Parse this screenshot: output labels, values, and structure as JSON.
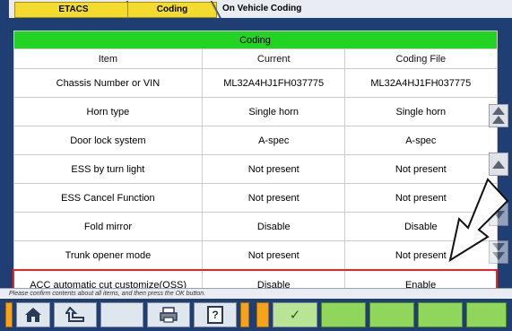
{
  "tabs": {
    "etacs": "ETACS",
    "coding": "Coding",
    "current": "On Vehicle Coding"
  },
  "table": {
    "title": "Coding",
    "headers": [
      "Item",
      "Current",
      "Coding File"
    ],
    "rows": [
      {
        "item": "Chassis Number or VIN",
        "current": "ML32A4HJ1FH037775",
        "file": "ML32A4HJ1FH037775"
      },
      {
        "item": "Horn type",
        "current": "Single horn",
        "file": "Single horn"
      },
      {
        "item": "Door lock system",
        "current": "A-spec",
        "file": "A-spec"
      },
      {
        "item": "ESS by turn light",
        "current": "Not present",
        "file": "Not present"
      },
      {
        "item": "ESS Cancel Function",
        "current": "Not present",
        "file": "Not present"
      },
      {
        "item": "Fold mirror",
        "current": "Disable",
        "file": "Disable"
      },
      {
        "item": "Trunk opener mode",
        "current": "Not present",
        "file": "Not present"
      },
      {
        "item": "ACC automatic cut customize(OSS)",
        "current": "Disable",
        "file": "Enable"
      }
    ]
  },
  "status": "Please confirm contents about all items, and then press the OK button.",
  "toolbar": {
    "help_label": "?",
    "ok_label": "✓"
  },
  "colors": {
    "frame_blue": "#1f3f74",
    "title_green": "#22d322",
    "highlight_red": "#e8242d",
    "tab_yellow": "#f3dc2e",
    "toolbar_orange": "#f6a21a",
    "toolbar_green": "#8fd65a"
  }
}
